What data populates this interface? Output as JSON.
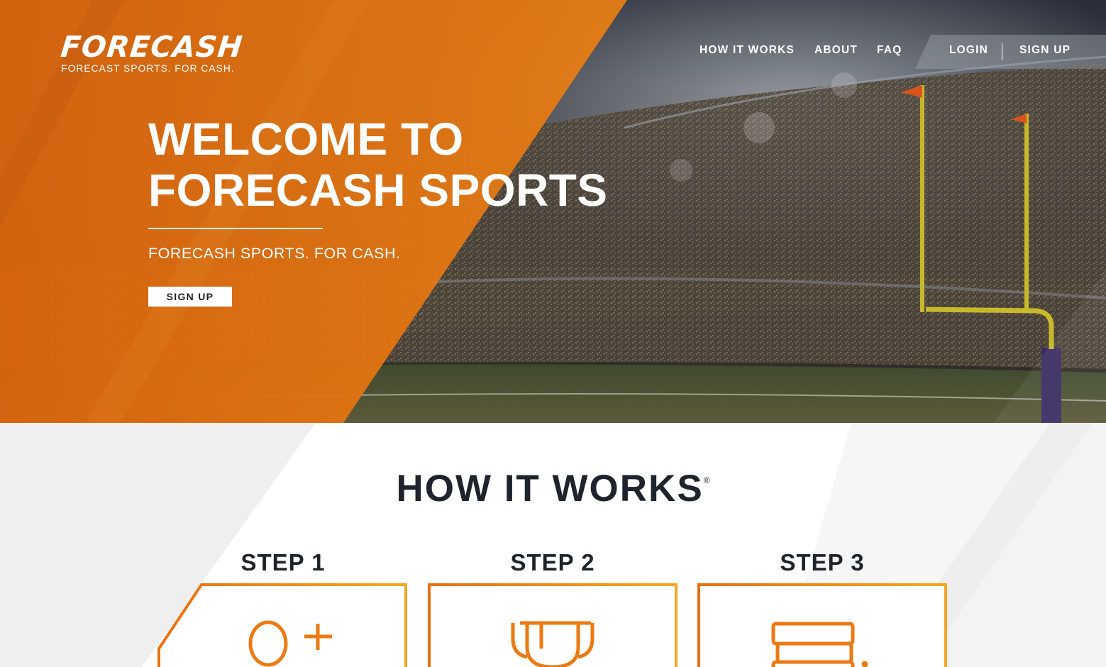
{
  "brand": {
    "logo_text": "FORECASH",
    "tagline": "FORECAST SPORTS. FOR CASH."
  },
  "nav": {
    "how_it_works": "HOW IT WORKS",
    "about": "ABOUT",
    "faq": "FAQ",
    "login": "LOGIN",
    "sign_up": "SIGN UP"
  },
  "hero": {
    "title_line1": "WELCOME TO",
    "title_line2": "FORECASH SPORTS",
    "subtitle": "FORECASH SPORTS. FOR CASH.",
    "cta": "SIGN UP"
  },
  "how_it_works": {
    "title": "HOW IT WORKS",
    "trademark": "®",
    "steps": [
      {
        "label": "STEP 1",
        "icon": "user-add-icon"
      },
      {
        "label": "STEP 2",
        "icon": "trophy-icon"
      },
      {
        "label": "STEP 3",
        "icon": "stack-icon"
      }
    ]
  },
  "colors": {
    "brand_orange": "#e8761a",
    "dark_text": "#1f232b",
    "white": "#ffffff"
  }
}
